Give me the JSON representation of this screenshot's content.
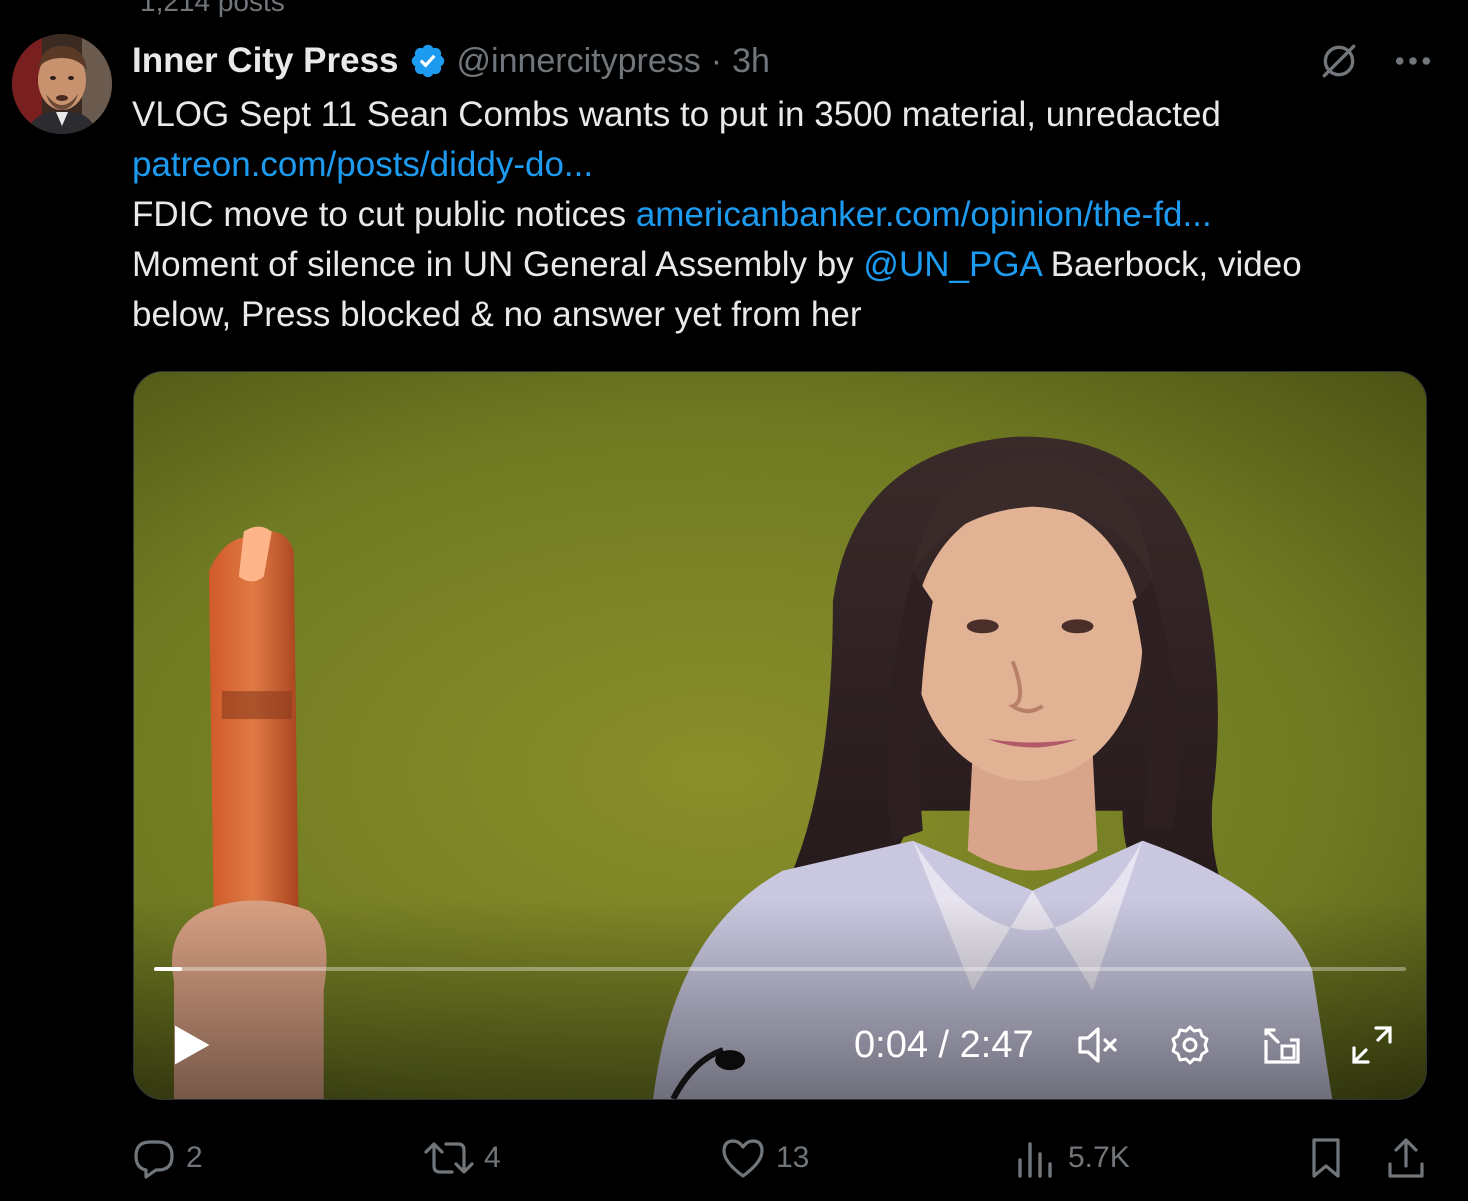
{
  "timeline": {
    "clipped_header_text": "1,214 posts"
  },
  "tweet": {
    "author_name": "Inner City Press",
    "author_handle": "@innercitypress",
    "separator": "·",
    "time": "3h",
    "text_lines": {
      "line1": "VLOG Sept 11 Sean Combs wants to put in 3500 material, unredacted",
      "link1": "patreon.com/posts/diddy-do...",
      "line3_text": "FDIC move to cut public notices ",
      "link2": "americanbanker.com/opinion/the-fd...",
      "line4_text": "Moment of silence in UN General Assembly by ",
      "mention": "@UN_PGA",
      "line4_after": " Baerbock, video",
      "line5": "below, Press blocked & no answer yet from her"
    },
    "icons": {
      "verified": "verified-badge-icon",
      "grok": "grok-icon",
      "more": "more-icon"
    },
    "accent_color": "#1d9bf0"
  },
  "video": {
    "current_time": "0:04",
    "duration": "2:47",
    "time_separator": " / ",
    "progress_fraction": 0.022,
    "icons": [
      "play-icon",
      "mute-icon",
      "settings-icon",
      "picture-in-picture-icon",
      "fullscreen-icon"
    ]
  },
  "actions": {
    "replies": "2",
    "reposts": "4",
    "likes": "13",
    "views": "5.7K",
    "icons": [
      "reply-icon",
      "repost-icon",
      "like-icon",
      "views-icon",
      "bookmark-icon",
      "share-icon"
    ]
  }
}
